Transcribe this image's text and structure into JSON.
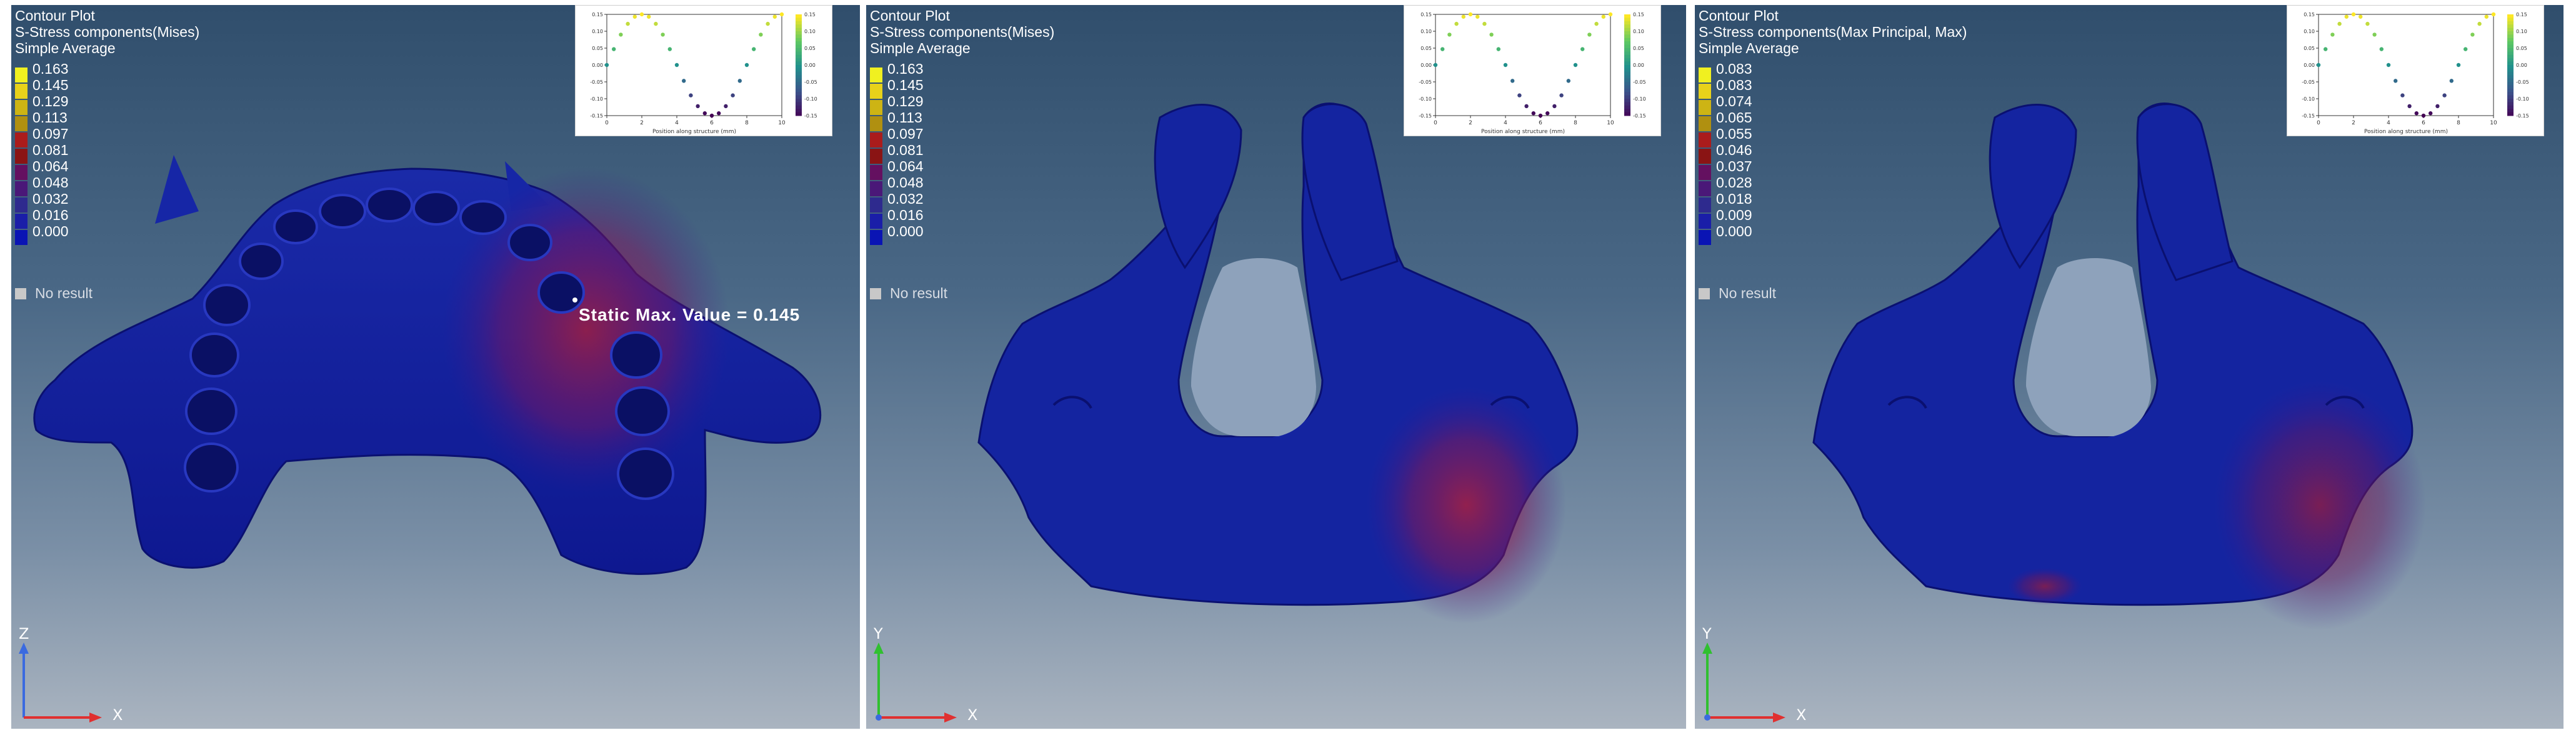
{
  "legend_colors": [
    "#f0f020",
    "#e8d21a",
    "#cdb414",
    "#b09010",
    "#aa1c1c",
    "#8a1414",
    "#641060",
    "#4a1878",
    "#2e2a8e",
    "#1a1ea8",
    "#0a14b4"
  ],
  "panels": [
    {
      "title": [
        "Contour Plot",
        "S-Stress components(Mises)",
        "Simple Average"
      ],
      "legend": [
        "0.163",
        "0.145",
        "0.129",
        "0.113",
        "0.097",
        "0.081",
        "0.064",
        "0.048",
        "0.032",
        "0.016",
        "0.000"
      ],
      "no_result": "No result",
      "max_label": "Static Max. Value = 0.145",
      "axes": {
        "up": "Z",
        "right": "X"
      }
    },
    {
      "title": [
        "Contour Plot",
        "S-Stress components(Mises)",
        "Simple Average"
      ],
      "legend": [
        "0.163",
        "0.145",
        "0.129",
        "0.113",
        "0.097",
        "0.081",
        "0.064",
        "0.048",
        "0.032",
        "0.016",
        "0.000"
      ],
      "no_result": "No result",
      "axes": {
        "up": "Y",
        "right": "X"
      }
    },
    {
      "title": [
        "Contour Plot",
        "S-Stress components(Max Principal, Max)",
        "Simple Average"
      ],
      "legend": [
        "0.083",
        "0.083",
        "0.074",
        "0.065",
        "0.055",
        "0.046",
        "0.037",
        "0.028",
        "0.018",
        "0.009",
        "0.000"
      ],
      "no_result": "No result",
      "axes": {
        "up": "Y",
        "right": "X"
      }
    }
  ],
  "inset_plot": {
    "xlabel": "Position along structure (mm)",
    "x_ticks": [
      "0",
      "2",
      "4",
      "6",
      "8",
      "10"
    ],
    "y_ticks": [
      "0.15",
      "0.10",
      "0.05",
      "0.00",
      "-0.05",
      "-0.10",
      "-0.15"
    ],
    "cbar_ticks": [
      "0.15",
      "0.10",
      "0.05",
      "0.00",
      "-0.05",
      "-0.10",
      "-0.15"
    ]
  },
  "chart_data": {
    "type": "scatter",
    "xlabel": "Position along structure (mm)",
    "xlim": [
      0,
      10
    ],
    "ylim": [
      -0.15,
      0.15
    ],
    "colormap": "viridis",
    "x": [
      0.0,
      0.4,
      0.8,
      1.2,
      1.6,
      2.0,
      2.4,
      2.8,
      3.2,
      3.6,
      4.0,
      4.4,
      4.8,
      5.2,
      5.6,
      6.0,
      6.4,
      6.8,
      7.2,
      7.6,
      8.0,
      8.4,
      8.8,
      9.2,
      9.6,
      10.0
    ],
    "y": [
      0.0,
      0.047,
      0.09,
      0.122,
      0.143,
      0.15,
      0.143,
      0.122,
      0.09,
      0.047,
      0.0,
      -0.047,
      -0.09,
      -0.122,
      -0.143,
      -0.15,
      -0.143,
      -0.122,
      -0.09,
      -0.047,
      0.0,
      0.047,
      0.09,
      0.122,
      0.143,
      0.15
    ]
  }
}
